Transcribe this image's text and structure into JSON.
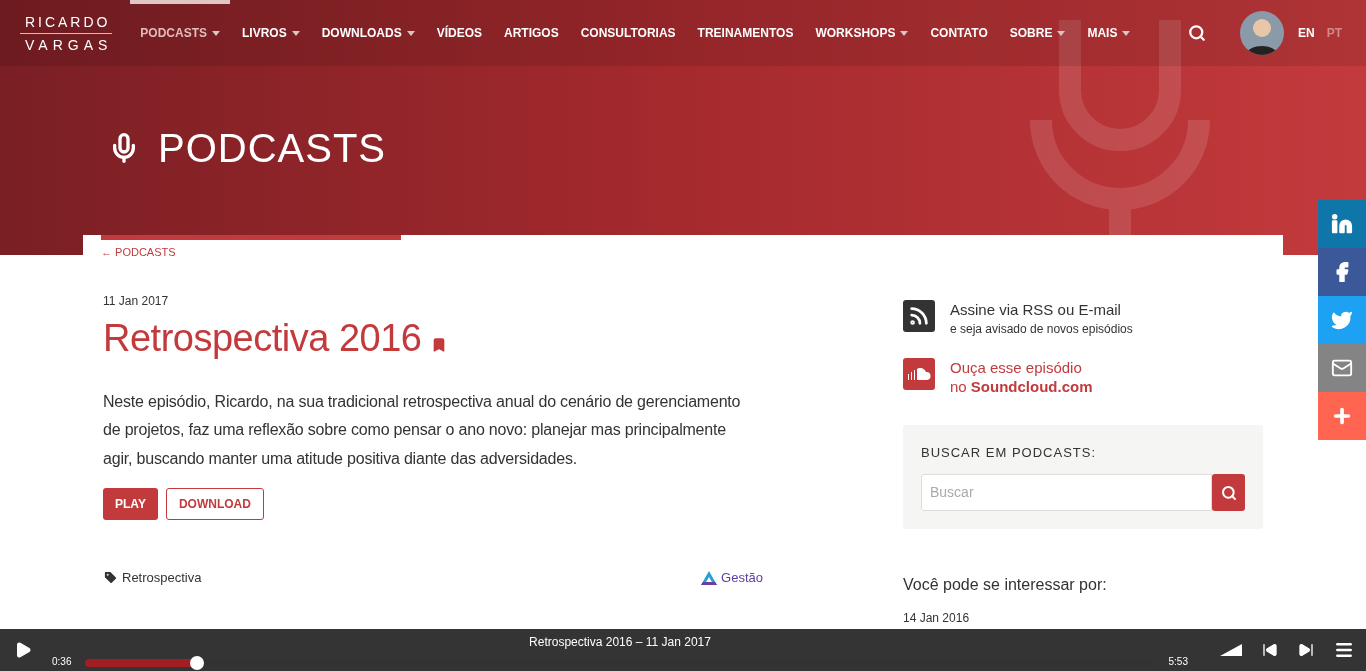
{
  "header": {
    "logo": [
      "RICARDO",
      "VARGAS"
    ],
    "nav": [
      {
        "label": "PODCASTS",
        "has_caret": true,
        "selected": true
      },
      {
        "label": "LIVROS",
        "has_caret": true,
        "selected": false
      },
      {
        "label": "DOWNLOADS",
        "has_caret": true,
        "selected": false
      },
      {
        "label": "VÍDEOS",
        "has_caret": false,
        "selected": false
      },
      {
        "label": "ARTIGOS",
        "has_caret": false,
        "selected": false
      },
      {
        "label": "CONSULTORIAS",
        "has_caret": false,
        "selected": false
      },
      {
        "label": "TREINAMENTOS",
        "has_caret": false,
        "selected": false
      },
      {
        "label": "WORKSHOPS",
        "has_caret": true,
        "selected": false
      },
      {
        "label": "CONTATO",
        "has_caret": false,
        "selected": false
      },
      {
        "label": "SOBRE",
        "has_caret": true,
        "selected": false
      },
      {
        "label": "MAIS",
        "has_caret": true,
        "selected": false
      }
    ],
    "languages": [
      {
        "label": "EN",
        "selected": true
      },
      {
        "label": "PT",
        "selected": false
      }
    ]
  },
  "hero": {
    "title": "PODCASTS"
  },
  "breadcrumb": "← PODCASTS",
  "episode": {
    "date": "11 Jan 2017",
    "title": "Retrospectiva 2016",
    "description": "Neste episódio, Ricardo, na sua tradicional retrospectiva anual do cenário de gerenciamento de projetos, faz uma reflexão sobre como pensar o ano novo: planejar mas principalmente agir, buscando manter uma atitude positiva diante das adversidades.",
    "buttons": [
      {
        "label": "PLAY",
        "kind": "primary"
      },
      {
        "label": "DOWNLOAD",
        "kind": "outline"
      }
    ],
    "tag": "Retrospectiva",
    "category": "Gestão"
  },
  "sidebar": {
    "subscribe": {
      "title": "Assine via RSS ou E-mail",
      "subtitle": "e seja avisado de novos episódios"
    },
    "soundcloud": {
      "lines": [
        "Ouça esse episódio",
        "no **Soundcloud.com**"
      ]
    },
    "search": {
      "heading": "BUSCAR EM PODCASTS:",
      "placeholder": "Buscar"
    },
    "related": {
      "heading": "Você pode se interessar por:",
      "items": [
        {
          "date": "14 Jan 2016"
        }
      ]
    }
  },
  "social": [
    {
      "kind": "linkedin",
      "color": "#0e76a8"
    },
    {
      "kind": "facebook",
      "color": "#3b5998"
    },
    {
      "kind": "twitter",
      "color": "#1da1f2"
    },
    {
      "kind": "email",
      "color": "#848484"
    },
    {
      "kind": "more",
      "color": "#ff6550"
    }
  ],
  "player": {
    "title": "Retrospectiva 2016 – 11 Jan 2017",
    "elapsed": "0:36",
    "duration": "5:53",
    "level": 0.104
  }
}
